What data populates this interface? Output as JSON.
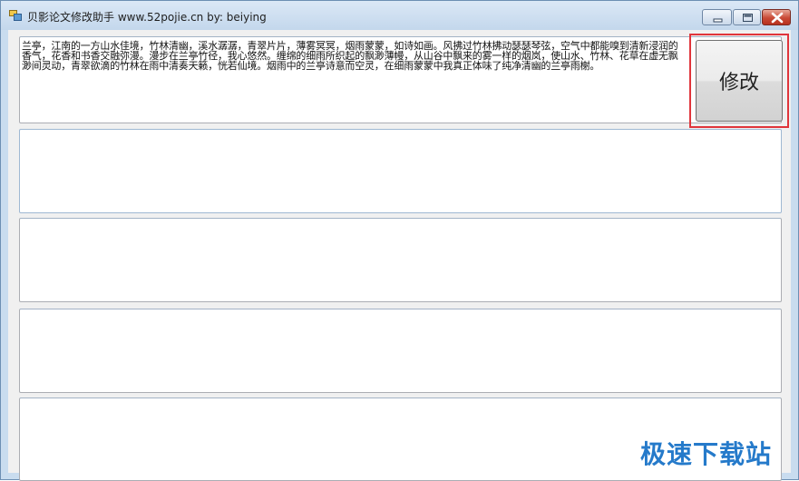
{
  "window": {
    "title": "贝影论文修改助手 www.52pojie.cn by: beiying",
    "icon": "app-window-icon",
    "controls": {
      "minimize_icon": "minimize-icon",
      "maximize_icon": "maximize-icon",
      "close_icon": "close-icon",
      "close_color": "#c94a36"
    }
  },
  "main": {
    "input_text": "兰亭，江南的一方山水佳境，竹林清幽，溪水潺潺，青翠片片，薄雾冥冥，烟雨蒙蒙，如诗如画。风拂过竹林拂动瑟瑟琴弦，空气中都能嗅到清新浸润的香气，花香和书香交融弥漫。漫步在兰亭竹径，我心悠然。缠绵的细雨所织起的飘渺薄幔，从山谷中飘来的雾一样的烟岚，使山水、竹林、花草在虚无飘渺间灵动，青翠欲滴的竹林在雨中清奏天籁，恍若仙境。烟雨中的兰亭诗意而空灵，在细雨蒙蒙中我真正体味了纯净清幽的兰亭雨榭。",
    "output_boxes": [
      "",
      "",
      "",
      ""
    ],
    "modify_button_label": "修改",
    "highlight_color": "#e0353b"
  },
  "watermark": {
    "text": "极速下载站",
    "color": "#1a73c8"
  }
}
